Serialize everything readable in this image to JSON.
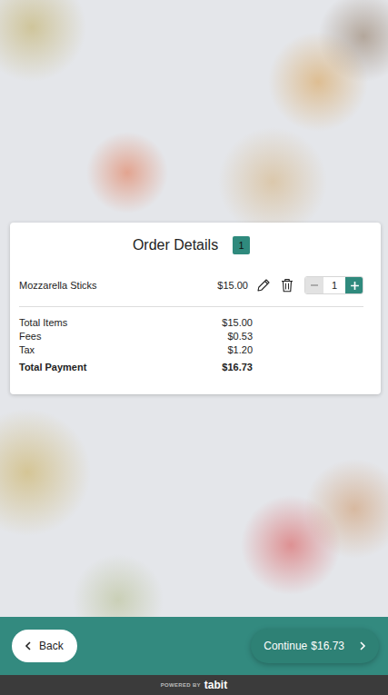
{
  "order": {
    "title": "Order Details",
    "count": "1"
  },
  "items": [
    {
      "name": "Mozzarella Sticks",
      "price": "$15.00",
      "quantity": "1"
    }
  ],
  "summary": [
    {
      "label": "Total Items",
      "value": "$15.00",
      "emphasized": false
    },
    {
      "label": "Fees",
      "value": "$0.53",
      "emphasized": false
    },
    {
      "label": "Tax",
      "value": "$1.20",
      "emphasized": false
    },
    {
      "label": "Total Payment",
      "value": "$16.73",
      "emphasized": true
    }
  ],
  "nav": {
    "back": "Back",
    "continue": "Continue",
    "continue_amount": "$16.73"
  },
  "footer": {
    "powered_by": "POWERED BY",
    "brand": "tabit"
  }
}
